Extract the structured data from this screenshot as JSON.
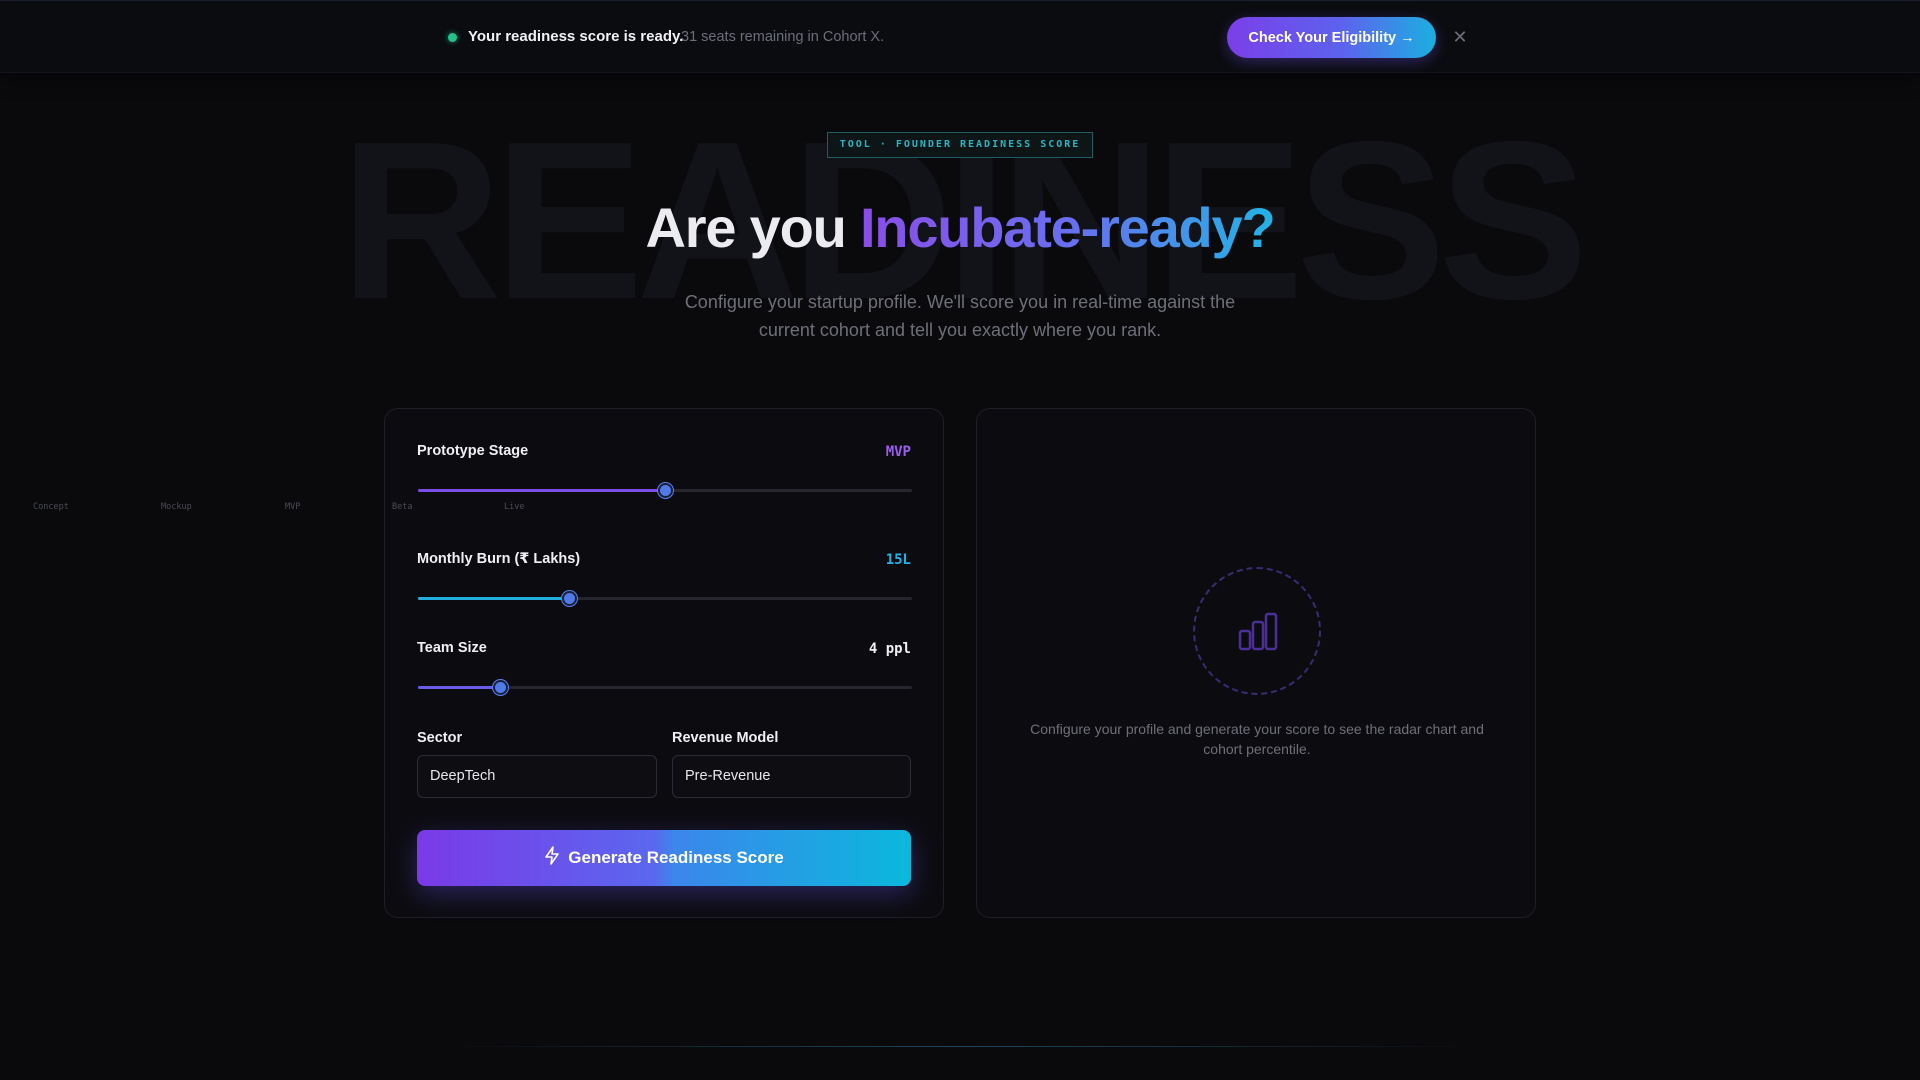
{
  "announcement": {
    "message": "Your readiness score is ready.",
    "sub": "31 seats remaining in Cohort X.",
    "cta_label": "Check Your Eligibility →",
    "close_glyph": "✕",
    "dot_color": "#22c28a"
  },
  "hero": {
    "background_word": "READINESS",
    "badge": "TOOL · FOUNDER READINESS SCORE",
    "headline_plain": "Are you ",
    "headline_accent": "Incubate-ready?",
    "subtitle": "Configure your startup profile. We'll score you in real-time against the current cohort and tell you exactly where you rank."
  },
  "form": {
    "prototype_stage": {
      "label": "Prototype Stage",
      "value": "MVP",
      "fraction": 0.5,
      "ticks": [
        "Concept",
        "Mockup",
        "MVP",
        "Beta",
        "Live"
      ]
    },
    "monthly_burn": {
      "label": "Monthly Burn (₹ Lakhs)",
      "value": "15L",
      "fraction": 0.305
    },
    "team_size": {
      "label": "Team Size",
      "value": "4 ppl",
      "fraction": 0.167
    },
    "sector": {
      "label": "Sector",
      "value": "DeepTech"
    },
    "revenue_model": {
      "label": "Revenue Model",
      "value": "Pre-Revenue"
    },
    "generate_label": "Generate Readiness Score"
  },
  "result": {
    "hint": "Configure your profile and generate your score to see the radar chart and cohort percentile.",
    "icon": "bar-chart-icon"
  },
  "colors": {
    "accent_purple": "#8b4de8",
    "accent_cyan": "#22b4e6",
    "thumb": "#4f7ae8"
  }
}
